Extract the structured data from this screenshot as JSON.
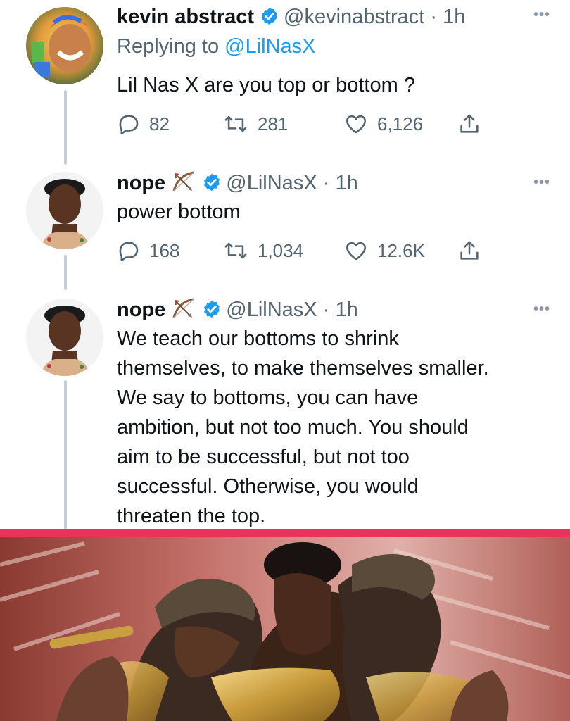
{
  "tweets": [
    {
      "name": "kevin abstract",
      "handle": "@kevinabstract",
      "time": "1h",
      "replying_prefix": "Replying to ",
      "replying_handle": "@LilNasX",
      "text": "Lil Nas X are you top or bottom ?",
      "replies": "82",
      "retweets": "281",
      "likes": "6,126"
    },
    {
      "name": "nope",
      "handle": "@LilNasX",
      "time": "1h",
      "text": "power bottom",
      "replies": "168",
      "retweets": "1,034",
      "likes": "12.6K"
    },
    {
      "name": "nope",
      "handle": "@LilNasX",
      "time": "1h",
      "text_lines": [
        "We teach our bottoms to shrink",
        "themselves, to make themselves smaller.",
        "We say to bottoms, you can have",
        "ambition, but not too much. You should",
        "aim to be successful, but not too",
        "successful. Otherwise, you would",
        "threaten the top."
      ]
    }
  ],
  "separator": " · ",
  "more_label": "•••",
  "icons": {
    "reply": "reply-icon",
    "retweet": "retweet-icon",
    "like": "heart-icon",
    "share": "share-icon",
    "verified": "verified-badge-icon",
    "bow": "bow-and-arrow-icon"
  },
  "colors": {
    "link": "#1d9bf0",
    "verified": "#1d9bf0",
    "secondary_text": "#536471",
    "divider": "#e8335a"
  }
}
